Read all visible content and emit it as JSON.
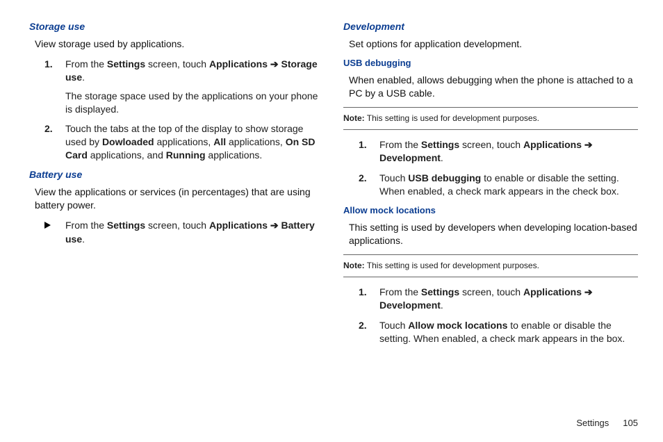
{
  "left": {
    "storage_use": {
      "heading": "Storage use",
      "intro": "View storage used by applications.",
      "steps": {
        "s1_pre": "From the ",
        "s1_b1": "Settings",
        "s1_mid": " screen, touch ",
        "s1_b2": "Applications",
        "s1_arrow": " ➔ ",
        "s1_b3": "Storage use",
        "s1_end": ".",
        "s1_sub": "The storage space used by the applications on your phone is displayed.",
        "s2_pre": "Touch the tabs at the top of the display to show storage used by ",
        "s2_b1": "Dowloaded",
        "s2_m1": " applications, ",
        "s2_b2": "All",
        "s2_m2": " applications, ",
        "s2_b3": "On SD Card",
        "s2_m3": " applications, and ",
        "s2_b4": "Running",
        "s2_end": " applications."
      }
    },
    "battery_use": {
      "heading": "Battery use",
      "intro": "View the applications or services (in percentages) that are using battery power.",
      "bullet": {
        "b1_pre": "From the ",
        "b1_b1": "Settings",
        "b1_mid": " screen, touch ",
        "b1_b2": "Applications",
        "b1_arrow": " ➔ ",
        "b1_b3": "Battery use",
        "b1_end": "."
      }
    }
  },
  "right": {
    "development": {
      "heading": "Development",
      "intro": "Set options for application development."
    },
    "usb_debugging": {
      "heading": "USB debugging",
      "intro": "When enabled, allows debugging when the phone is attached to a PC by a USB cable.",
      "note_label": "Note:",
      "note_text": " This setting is used for development purposes.",
      "steps": {
        "s1_pre": "From the ",
        "s1_b1": "Settings",
        "s1_mid": " screen, touch ",
        "s1_b2": "Applications",
        "s1_arrow": " ➔ ",
        "s1_b3": "Development",
        "s1_end": ".",
        "s2_pre": "Touch ",
        "s2_b1": "USB debugging ",
        "s2_end": " to enable or disable the setting. When enabled, a check mark appears in the check box."
      }
    },
    "allow_mock": {
      "heading": "Allow mock locations",
      "intro": "This setting is used by developers when developing location-based applications.",
      "note_label": "Note:",
      "note_text": " This setting is used for development purposes.",
      "steps": {
        "s1_pre": "From the ",
        "s1_b1": "Settings",
        "s1_mid": " screen, touch ",
        "s1_b2": "Applications",
        "s1_arrow": " ➔ ",
        "s1_b3": "Development",
        "s1_end": ".",
        "s2_pre": "Touch ",
        "s2_b1": "Allow mock locations",
        "s2_end": " to enable or disable the setting. When enabled, a check mark appears in the box."
      }
    }
  },
  "footer": {
    "section": "Settings",
    "page": "105"
  }
}
